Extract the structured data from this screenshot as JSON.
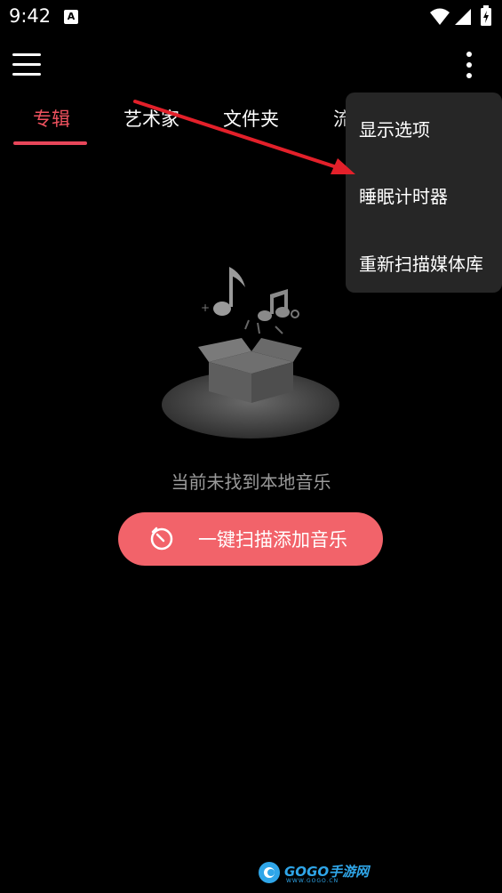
{
  "status_bar": {
    "time": "9:42",
    "notification_icon": "a-icon",
    "wifi_icon": "wifi-icon",
    "signal_icon": "signal-icon",
    "battery_icon": "battery-icon"
  },
  "toolbar": {
    "menu_icon": "menu-icon",
    "more_icon": "more-vert-icon"
  },
  "tabs": [
    {
      "label": "专辑",
      "active": true
    },
    {
      "label": "艺术家",
      "active": false
    },
    {
      "label": "文件夹",
      "active": false
    },
    {
      "label": "流",
      "active": false
    }
  ],
  "overflow_menu": {
    "items": [
      {
        "label": "显示选项"
      },
      {
        "label": "睡眠计时器"
      },
      {
        "label": "重新扫描媒体库"
      }
    ]
  },
  "empty_state": {
    "message": "当前未找到本地音乐",
    "illustration_icon": "music-box-icon"
  },
  "scan_button": {
    "label": "一键扫描添加音乐",
    "icon": "scan-icon"
  },
  "watermark": {
    "text": "GOGO手游网",
    "subtext": "WWW.GOGO.CN"
  },
  "colors": {
    "accent": "#f0525f",
    "button": "#f2636a",
    "menu_bg": "#262626",
    "annotation_arrow": "#e3202a"
  }
}
